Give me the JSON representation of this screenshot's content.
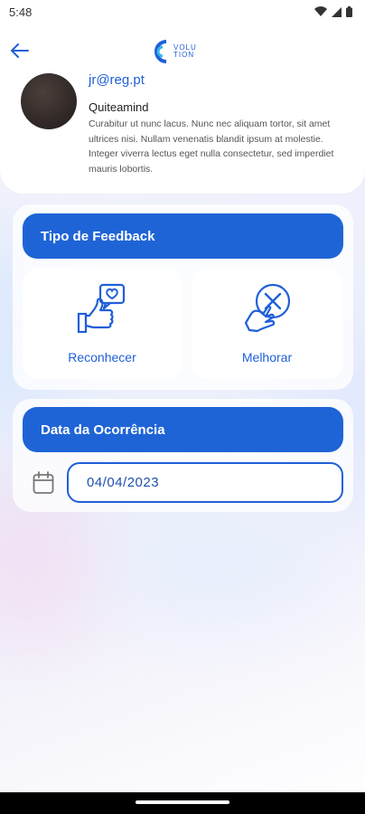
{
  "status_bar": {
    "time": "5:48"
  },
  "header": {
    "logo_text_line1": "VOLU",
    "logo_text_line2": "TION"
  },
  "profile": {
    "email": "jr@reg.pt",
    "company": "Quiteamind",
    "description": "Curabitur ut nunc lacus. Nunc nec aliquam tortor, sit amet ultrices nisi. Nullam venenatis blandit ipsum at molestie. Integer viverra lectus eget nulla consectetur, sed imperdiet mauris lobortis."
  },
  "feedback_type": {
    "title": "Tipo de Feedback",
    "options": [
      {
        "label": "Reconhecer",
        "icon": "thumbs-up-heart-icon"
      },
      {
        "label": "Melhorar",
        "icon": "hand-cross-icon"
      }
    ]
  },
  "occurrence_date": {
    "title": "Data da Ocorrência",
    "value": "04/04/2023",
    "icon": "calendar-icon"
  },
  "colors": {
    "accent": "#1f64d6",
    "text_accent": "#1f5fd8"
  }
}
